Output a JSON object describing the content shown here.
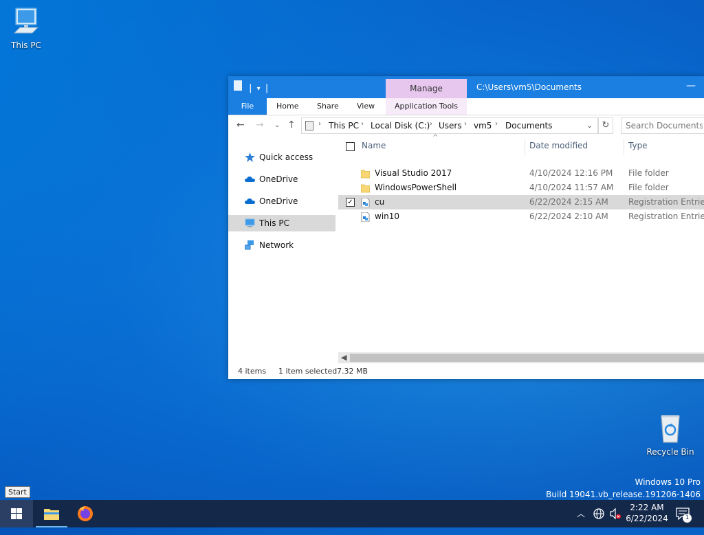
{
  "desktop": {
    "this_pc_label": "This PC",
    "recycle_bin_label": "Recycle Bin",
    "watermark_edition": "Windows 10 Pro",
    "watermark_build": "Build 19041.vb_release.191206-1406"
  },
  "window": {
    "title_path": "C:\\Users\\vm5\\Documents",
    "contextual_tab": "Manage",
    "ribbon_tabs": {
      "file": "File",
      "home": "Home",
      "share": "Share",
      "view": "View",
      "app_tools": "Application Tools"
    },
    "address": {
      "segments": [
        "This PC",
        "Local Disk (C:)",
        "Users",
        "vm5",
        "Documents"
      ]
    },
    "search": {
      "placeholder": "Search Documents"
    },
    "nav_pane": {
      "items": [
        {
          "label": "Quick access",
          "icon": "star-icon"
        },
        {
          "label": "OneDrive",
          "icon": "cloud-icon"
        },
        {
          "label": "OneDrive",
          "icon": "cloud-icon"
        },
        {
          "label": "This PC",
          "icon": "computer-icon",
          "selected": true
        },
        {
          "label": "Network",
          "icon": "network-icon"
        }
      ]
    },
    "columns": {
      "name": "Name",
      "date_modified": "Date modified",
      "type": "Type"
    },
    "files": [
      {
        "name": "Visual Studio 2017",
        "date": "4/10/2024 12:16 PM",
        "type": "File folder",
        "icon": "folder-icon",
        "selected": false
      },
      {
        "name": "WindowsPowerShell",
        "date": "4/10/2024 11:57 AM",
        "type": "File folder",
        "icon": "folder-icon",
        "selected": false
      },
      {
        "name": "cu",
        "date": "6/22/2024 2:15 AM",
        "type": "Registration Entries",
        "icon": "registry-file-icon",
        "selected": true
      },
      {
        "name": "win10",
        "date": "6/22/2024 2:10 AM",
        "type": "Registration Entries",
        "icon": "registry-file-icon",
        "selected": false
      }
    ],
    "status": {
      "item_count": "4 items",
      "selection": "1 item selected",
      "size": "7.32 MB"
    }
  },
  "taskbar": {
    "start_tooltip": "Start",
    "clock_time": "2:22 AM",
    "clock_date": "6/22/2024",
    "notification_count": "1"
  },
  "colors": {
    "accent": "#1a7fe0",
    "manage_tab": "#e8c7ee",
    "taskbar": "#14284a",
    "selection": "#d9d9d9"
  }
}
